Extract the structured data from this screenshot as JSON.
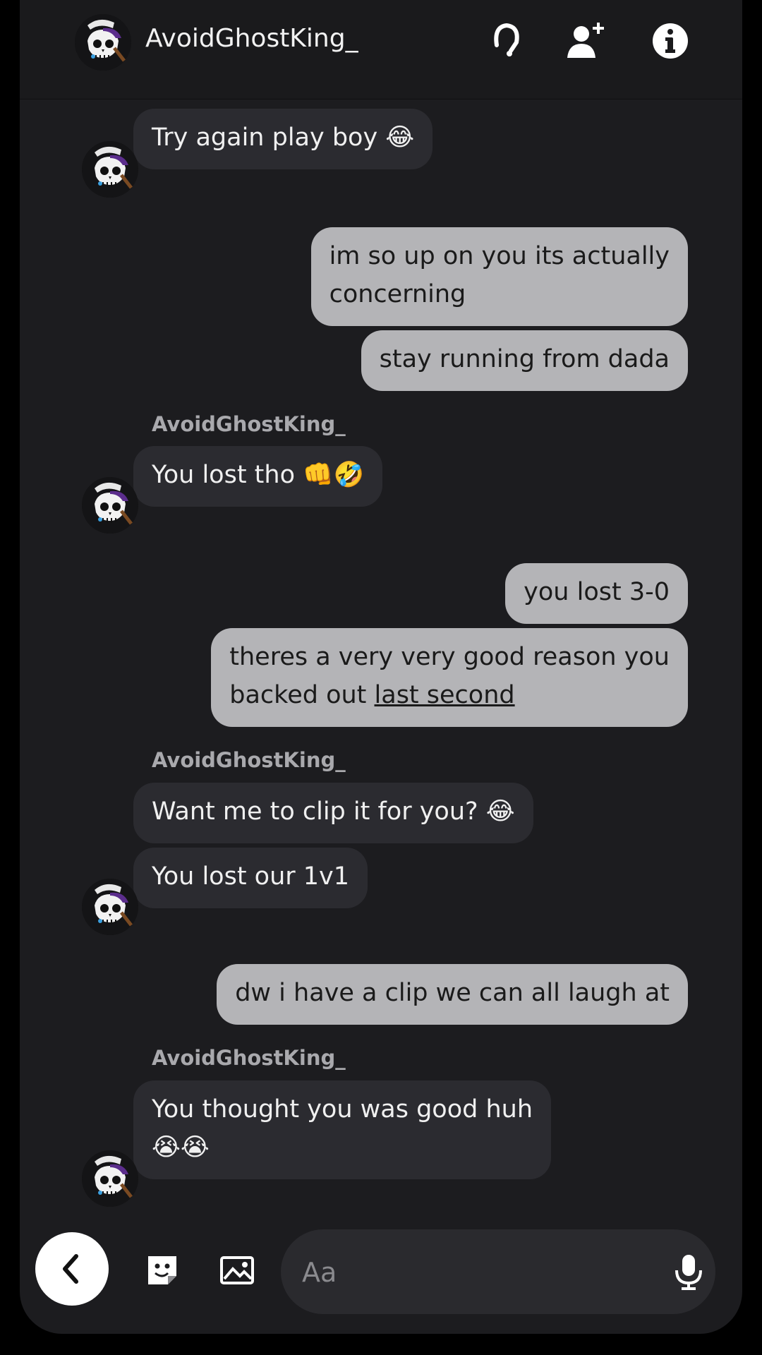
{
  "header": {
    "contact_name": "AvoidGhostKing_",
    "icons": [
      "headset-icon",
      "add-friend-icon",
      "info-icon"
    ]
  },
  "messages": [
    {
      "from": "them",
      "text": "Try again play boy 😂"
    },
    {
      "from": "me",
      "line1": "im so up on you its actually",
      "line2": "concerning"
    },
    {
      "from": "me",
      "text": "stay running from dada"
    },
    {
      "from": "them",
      "sender": "AvoidGhostKing_",
      "text": "You lost tho 👊🤣"
    },
    {
      "from": "me",
      "text": "you lost 3-0"
    },
    {
      "from": "me",
      "line1": "theres a very very good reason you",
      "line2_prefix": "backed out ",
      "line2_link": "last second"
    },
    {
      "from": "them",
      "sender": "AvoidGhostKing_",
      "text": "Want me to clip it for you? 😂"
    },
    {
      "from": "them",
      "text": "You lost our 1v1"
    },
    {
      "from": "me",
      "text": "dw i have a clip we can all laugh at"
    },
    {
      "from": "them",
      "sender": "AvoidGhostKing_",
      "line1": "You thought you was good huh",
      "line2": "😭😭"
    }
  ],
  "composer": {
    "placeholder": "Aa",
    "icons": [
      "back-icon",
      "sticker-icon",
      "image-icon",
      "microphone-icon"
    ]
  },
  "colors": {
    "background": "#1c1c1f",
    "incoming_bubble": "#2b2b30",
    "outgoing_bubble": "#b4b4b7"
  }
}
